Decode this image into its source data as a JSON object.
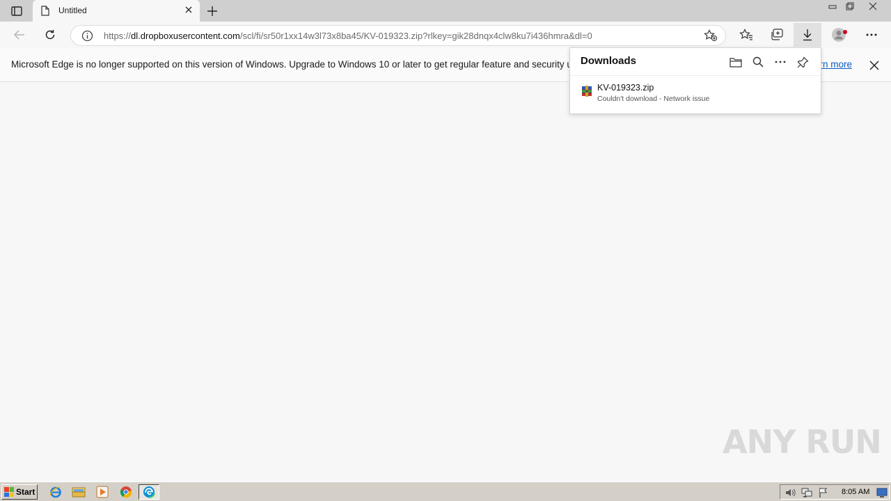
{
  "browser": {
    "tab": {
      "title": "Untitled"
    },
    "address": {
      "scheme": "https://",
      "host": "dl.dropboxusercontent.com",
      "path": "/scl/fi/sr50r1xx14w3l73x8ba45/KV-019323.zip?rlkey=gik28dnqx4clw8ku7i436hmra&dl=0"
    }
  },
  "infobar": {
    "message": "Microsoft Edge is no longer supported on this version of Windows. Upgrade to Windows 10 or later to get regular feature and security u",
    "link": "arn more"
  },
  "downloads": {
    "title": "Downloads",
    "items": [
      {
        "name": "KV-019323.zip",
        "status": "Couldn't download - Network issue"
      }
    ]
  },
  "watermark": {
    "text": "ANY RUN"
  },
  "taskbar": {
    "start_label": "Start",
    "clock": "8:05 AM"
  },
  "colors": {
    "accent_link": "#0a5bc4",
    "profile_badge": "#d0021b"
  }
}
